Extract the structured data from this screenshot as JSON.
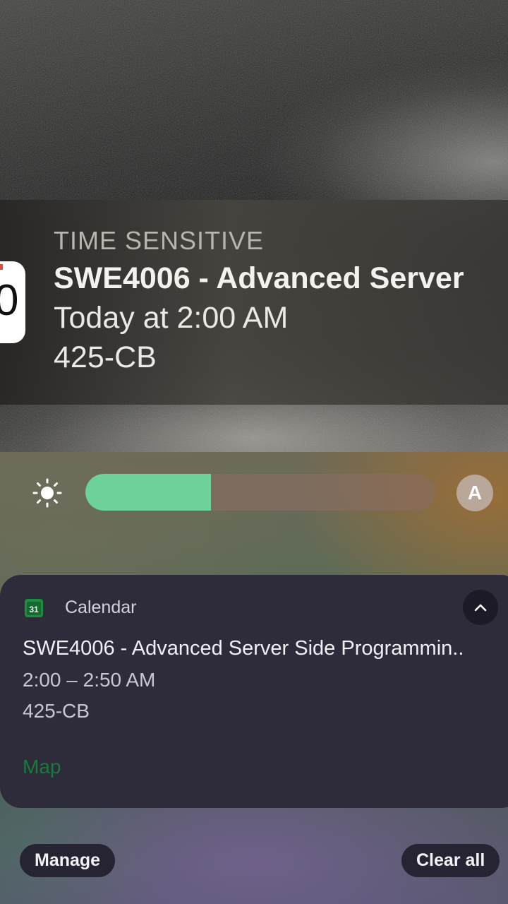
{
  "lock_screen_banner": {
    "app_icon": "calendar-icon",
    "app_icon_digit": "0",
    "label": "TIME SENSITIVE",
    "title": "SWE4006 - Advanced Server",
    "time": "Today at 2:00 AM",
    "location": "425-CB"
  },
  "brightness": {
    "icon": "sun-icon",
    "level": 0.36,
    "auto_label": "A",
    "fill_color": "#6dd39a"
  },
  "notification": {
    "app_icon": "google-calendar-icon",
    "app_icon_text": "31",
    "app_name": "Calendar",
    "collapse_icon": "chevron-up-icon",
    "title": "SWE4006 - Advanced Server Side Programmin..",
    "time": "2:00 – 2:50 AM",
    "location": "425-CB",
    "action_label": "Map",
    "action_color": "#1a7a3c"
  },
  "footer": {
    "manage_label": "Manage",
    "clear_all_label": "Clear all"
  }
}
